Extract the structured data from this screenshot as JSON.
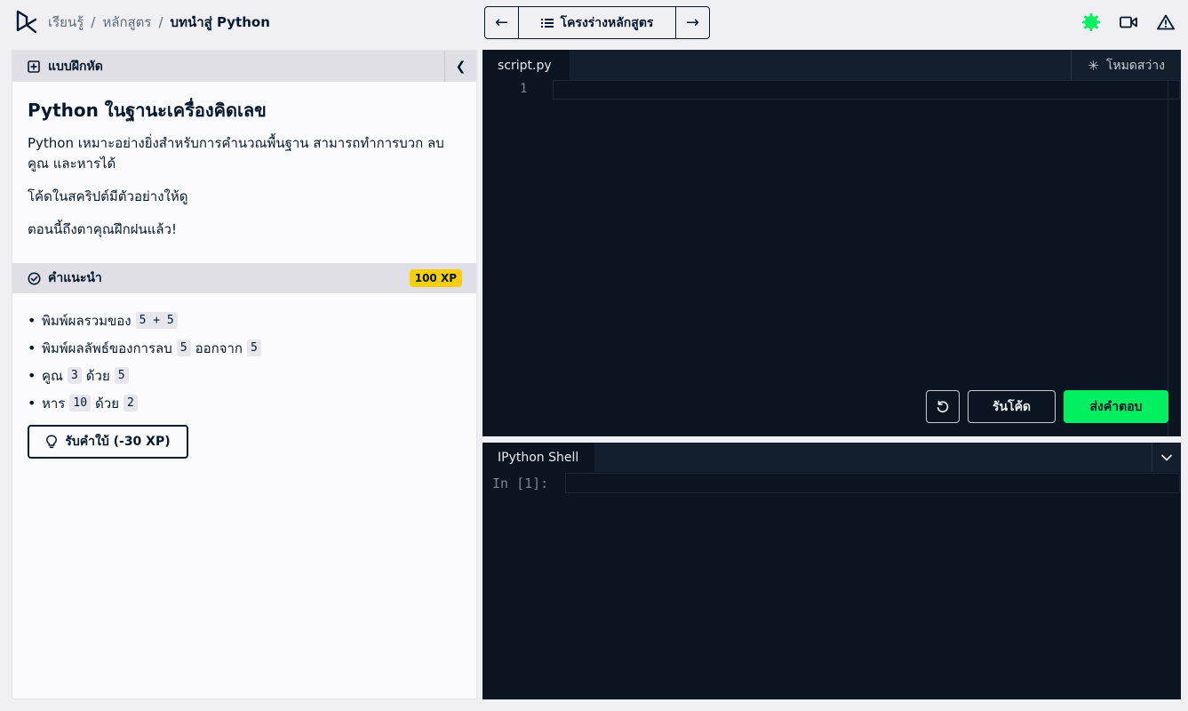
{
  "breadcrumb": {
    "items": [
      "เรียนรู้",
      "หลักสูตร"
    ],
    "separator": "/",
    "current": "บทนำสู่ Python"
  },
  "course_nav": {
    "prev_icon": "arrow-left-icon",
    "outline_label": "โครงร่างหลักสูตร",
    "next_icon": "arrow-right-icon"
  },
  "top_icons": [
    "status-gear-icon",
    "video-icon",
    "warning-icon"
  ],
  "exercise": {
    "tab_label": "แบบฝึกหัด",
    "title": "Python ในฐานะเครื่องคิดเลข",
    "paragraphs": [
      "Python เหมาะอย่างยิ่งสำหรับการคำนวณพื้นฐาน สามารถทำการบวก ลบ คูณ และหารได้",
      "โค้ดในสคริปต์มีตัวอย่างให้ดู",
      "ตอนนี้ถึงตาคุณฝึกฝนแล้ว!"
    ]
  },
  "instructions": {
    "label": "คำแนะนำ",
    "xp": "100 XP",
    "items": [
      {
        "text1": "พิมพ์ผลรวมของ",
        "code1": "5 + 5"
      },
      {
        "text1": "พิมพ์ผลลัพธ์ของการลบ",
        "code1": "5",
        "text2": "ออกจาก",
        "code2": "5"
      },
      {
        "text1": "คูณ",
        "code1": "3",
        "text2": "ด้วย",
        "code2": "5"
      },
      {
        "text1": "หาร",
        "code1": "10",
        "text2": "ด้วย",
        "code2": "2"
      }
    ],
    "hint_button": "รับคำใบ้ (-30 XP)"
  },
  "editor": {
    "file_tab": "script.py",
    "light_mode_label": "โหมดสว่าง",
    "line_number": "1",
    "run_label": "รันโค้ด",
    "submit_label": "ส่งคำตอบ"
  },
  "console": {
    "tab_label": "IPython Shell",
    "prompt": "In [1]:"
  },
  "colors": {
    "accent_green": "#03ef62",
    "xp_yellow": "#fcce0d",
    "editor_bg": "#0b1522",
    "navy": "#05192d"
  }
}
